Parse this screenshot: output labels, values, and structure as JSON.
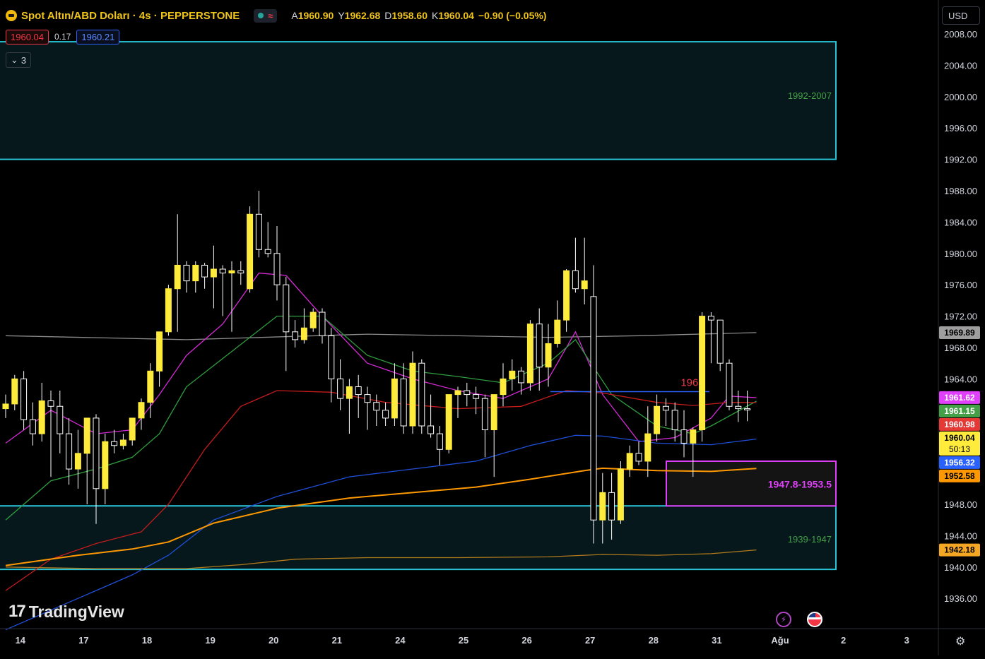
{
  "header": {
    "symbol_title": "Spot Altın/ABD Doları · 4s · PEPPERSTONE",
    "ohlc": [
      {
        "k": "A",
        "v": "1960.90"
      },
      {
        "k": "Y",
        "v": "1962.68"
      },
      {
        "k": "D",
        "v": "1958.60"
      },
      {
        "k": "K",
        "v": "1960.04"
      }
    ],
    "change": "−0.90 (−0.05%)",
    "sell_price": "1960.04",
    "spread": "0.17",
    "buy_price": "1960.21",
    "indicators_count": "3",
    "currency": "USD",
    "icons": [
      "gold-coin-icon",
      "market-open-dot-icon",
      "wave-icon",
      "chevron-down-icon",
      "bolt-icon",
      "us-flag-icon",
      "gear-icon"
    ]
  },
  "branding": {
    "logo_text": "TradingView",
    "logo_mark": "17"
  },
  "chart_data": {
    "type": "candlestick",
    "y_axis": {
      "range": [
        1933,
        2010
      ],
      "ticks": [
        2008,
        2004,
        2000,
        1996,
        1992,
        1988,
        1984,
        1980,
        1976,
        1972,
        1968,
        1964,
        1960,
        1956,
        1952,
        1948,
        1944,
        1940,
        1936
      ],
      "tick_labels": [
        "2008.00",
        "2004.00",
        "2000.00",
        "1996.00",
        "1992.00",
        "1988.00",
        "1984.00",
        "1980.00",
        "1976.00",
        "1972.00",
        "1968.00",
        "1964.00",
        "1960.00",
        "1956.00",
        "1952.00",
        "1948.00",
        "1944.00",
        "1940.00",
        "1936.00"
      ]
    },
    "x_axis": {
      "tick_labels": [
        "14",
        "17",
        "18",
        "19",
        "20",
        "21",
        "24",
        "25",
        "26",
        "27",
        "28",
        "31",
        "Ağu",
        "2",
        "3"
      ],
      "tick_bar_index": [
        1,
        8,
        15,
        22,
        29,
        36,
        43,
        50,
        57,
        64,
        71,
        78,
        85,
        92,
        99
      ]
    },
    "candles": [
      [
        1960.2,
        1962,
        1959,
        1960.8
      ],
      [
        1960.8,
        1964.5,
        1960,
        1964
      ],
      [
        1964,
        1965,
        1957.5,
        1958.8
      ],
      [
        1958.8,
        1961,
        1955.5,
        1957
      ],
      [
        1957,
        1963.5,
        1956,
        1961.2
      ],
      [
        1961.2,
        1962.5,
        1951.5,
        1960.5
      ],
      [
        1960.5,
        1962.5,
        1954.5,
        1957
      ],
      [
        1957,
        1959,
        1950.5,
        1952.5
      ],
      [
        1952.5,
        1957.5,
        1950,
        1954.5
      ],
      [
        1954.5,
        1958,
        1948,
        1959
      ],
      [
        1959,
        1959.5,
        1945.5,
        1950
      ],
      [
        1950,
        1957,
        1948,
        1956
      ],
      [
        1956,
        1957.5,
        1954.5,
        1955.5
      ],
      [
        1955.5,
        1957,
        1955,
        1956.2
      ],
      [
        1956.2,
        1959,
        1955.5,
        1959
      ],
      [
        1959,
        1961.5,
        1957.5,
        1961
      ],
      [
        1961,
        1966,
        1959,
        1965
      ],
      [
        1965,
        1969,
        1963,
        1970
      ],
      [
        1970,
        1976,
        1969.5,
        1975.5
      ],
      [
        1975.5,
        1985,
        1970,
        1978.5
      ],
      [
        1978.5,
        1979,
        1975,
        1976.5
      ],
      [
        1976.5,
        1979,
        1975,
        1978.5
      ],
      [
        1978.5,
        1978.8,
        1975.5,
        1977
      ],
      [
        1977,
        1981,
        1973,
        1978
      ],
      [
        1978,
        1978.5,
        1972,
        1977.5
      ],
      [
        1977.5,
        1979,
        1970,
        1977.8
      ],
      [
        1977.8,
        1979,
        1976,
        1977.5
      ],
      [
        1975.5,
        1986,
        1975,
        1985
      ],
      [
        1985,
        1988,
        1979.5,
        1980.5
      ],
      [
        1980.5,
        1984,
        1979.5,
        1980
      ],
      [
        1980,
        1983.5,
        1974,
        1976
      ],
      [
        1976,
        1977,
        1965,
        1970
      ],
      [
        1970,
        1971.5,
        1968,
        1969
      ],
      [
        1969,
        1973,
        1968.5,
        1970.5
      ],
      [
        1970.5,
        1973,
        1970,
        1972.5
      ],
      [
        1972.5,
        1973,
        1968.5,
        1969.5
      ],
      [
        1969.5,
        1970.5,
        1961,
        1964
      ],
      [
        1964,
        1966.5,
        1960,
        1961.5
      ],
      [
        1961.5,
        1964,
        1957,
        1963
      ],
      [
        1963,
        1964.5,
        1959,
        1962
      ],
      [
        1962,
        1963,
        1957.5,
        1961
      ],
      [
        1961,
        1962,
        1958,
        1960
      ],
      [
        1960,
        1961,
        1958,
        1959
      ],
      [
        1959,
        1966,
        1958,
        1964
      ],
      [
        1964,
        1966,
        1957,
        1958
      ],
      [
        1958,
        1967.5,
        1957,
        1966
      ],
      [
        1966,
        1966.5,
        1957,
        1958
      ],
      [
        1958,
        1962,
        1956.5,
        1957
      ],
      [
        1957,
        1958,
        1953,
        1955
      ],
      [
        1955,
        1962,
        1954.5,
        1962
      ],
      [
        1962,
        1963,
        1959,
        1962.5
      ],
      [
        1962.5,
        1963.5,
        1960.5,
        1962
      ],
      [
        1962,
        1963,
        1959.5,
        1961.5
      ],
      [
        1961.5,
        1962,
        1954,
        1957.5
      ],
      [
        1957.5,
        1962,
        1951.5,
        1962
      ],
      [
        1962,
        1966,
        1960.5,
        1964
      ],
      [
        1964,
        1966.5,
        1962.5,
        1965
      ],
      [
        1965,
        1965.5,
        1962,
        1963.5
      ],
      [
        1963.5,
        1971.5,
        1962.5,
        1971
      ],
      [
        1971,
        1973,
        1962.5,
        1965.5
      ],
      [
        1965.5,
        1971,
        1963,
        1968.5
      ],
      [
        1968.5,
        1974,
        1968,
        1971.5
      ],
      [
        1971.5,
        1978,
        1970,
        1977.8
      ],
      [
        1977.8,
        1982,
        1975,
        1975.5
      ],
      [
        1975.5,
        1982,
        1973.5,
        1976.5
      ],
      [
        1974.5,
        1978.5,
        1943,
        1946
      ],
      [
        1946,
        1952,
        1943,
        1949.5
      ],
      [
        1949.5,
        1952,
        1943.5,
        1946
      ],
      [
        1946,
        1953.5,
        1945.5,
        1952.5
      ],
      [
        1952.5,
        1955.5,
        1951.5,
        1954.5
      ],
      [
        1954.5,
        1956,
        1953,
        1953.5
      ],
      [
        1953.5,
        1960.5,
        1951.5,
        1957
      ],
      [
        1957,
        1962,
        1956,
        1960.5
      ],
      [
        1960.5,
        1961.5,
        1958,
        1960
      ],
      [
        1960,
        1961,
        1956,
        1957.5
      ],
      [
        1957.5,
        1960,
        1954,
        1955.8
      ],
      [
        1955.8,
        1957.8,
        1951.5,
        1957.5
      ],
      [
        1957.5,
        1972.5,
        1956,
        1972
      ],
      [
        1972,
        1972.5,
        1966,
        1971.5
      ],
      [
        1971.5,
        1971.5,
        1965,
        1966
      ],
      [
        1966,
        1966.5,
        1960,
        1960.5
      ],
      [
        1960.5,
        1962.5,
        1958.5,
        1960.2
      ],
      [
        1960.2,
        1962.5,
        1958.6,
        1960.04
      ]
    ],
    "zones": [
      {
        "label": "1992-2007",
        "from": 1992,
        "to": 2007
      },
      {
        "label": "1939-1947",
        "from": 1939.7,
        "to": 1947.8
      },
      {
        "label": "1947.8-1953.5",
        "from": 1947.8,
        "to": 1953.5
      }
    ],
    "horizontal_levels": [
      {
        "label": "1963",
        "price": 1963
      }
    ],
    "price_labels": [
      {
        "text": "1969.89",
        "price": 1969.89,
        "color": "#9e9e9e"
      },
      {
        "text": "1961.62",
        "price": 1961.62,
        "color": "#e040fb"
      },
      {
        "text": "1961.15",
        "price": 1961.15,
        "color": "#43a047"
      },
      {
        "text": "1960.98",
        "price": 1960.98,
        "color": "#e53935"
      },
      {
        "text": "1960.04",
        "price": 1960.04,
        "color": "#ffeb3b",
        "subtext": "50:13"
      },
      {
        "text": "1956.32",
        "price": 1956.32,
        "color": "#2962ff"
      },
      {
        "text": "1952.58",
        "price": 1952.58,
        "color": "#ff9800"
      },
      {
        "text": "1942.18",
        "price": 1942.18,
        "color": "#f5a623"
      }
    ],
    "colors": {
      "candle_up": "#ffeb3b",
      "candle_down": "#000000",
      "wick": "#ffffff",
      "zone_border": "#29c5d6",
      "zone_fill": "#06181c",
      "zone_label": "#43a047",
      "zone3_border": "#e040fb",
      "zone3_label": "#e040fb",
      "level_line": "#2962ff",
      "level_label": "#f23645",
      "ma_gray": "#8a8a8a",
      "ma_magenta": "#d62ad6",
      "ma_green": "#2e9e3e",
      "ma_red": "#c41c1c",
      "ma_blue": "#1e4fd8",
      "ma_orange": "#ff9800",
      "ma_darkorange": "#b07a1a"
    },
    "moving_averages": [
      {
        "color": "#8a8a8a",
        "points": [
          [
            0,
            1969.5
          ],
          [
            20,
            1969
          ],
          [
            40,
            1969.7
          ],
          [
            60,
            1969.3
          ],
          [
            70,
            1969.5
          ],
          [
            83,
            1969.9
          ]
        ]
      },
      {
        "color": "#d62ad6",
        "points": [
          [
            0,
            1955.8
          ],
          [
            5,
            1960
          ],
          [
            10,
            1957
          ],
          [
            14,
            1957.5
          ],
          [
            17,
            1962
          ],
          [
            20,
            1967
          ],
          [
            24,
            1971
          ],
          [
            28,
            1977.5
          ],
          [
            31,
            1977.2
          ],
          [
            35,
            1972
          ],
          [
            40,
            1966
          ],
          [
            45,
            1964
          ],
          [
            50,
            1962.5
          ],
          [
            55,
            1961.5
          ],
          [
            60,
            1964
          ],
          [
            63,
            1970
          ],
          [
            66,
            1962
          ],
          [
            70,
            1956
          ],
          [
            74,
            1956.5
          ],
          [
            78,
            1959
          ],
          [
            80,
            1961.8
          ],
          [
            83,
            1961.6
          ]
        ]
      },
      {
        "color": "#2e9e3e",
        "points": [
          [
            0,
            1946
          ],
          [
            5,
            1951
          ],
          [
            10,
            1952.5
          ],
          [
            14,
            1954
          ],
          [
            17,
            1957
          ],
          [
            20,
            1963
          ],
          [
            25,
            1967.5
          ],
          [
            30,
            1972
          ],
          [
            35,
            1972
          ],
          [
            40,
            1967
          ],
          [
            45,
            1965
          ],
          [
            50,
            1964.3
          ],
          [
            55,
            1963.5
          ],
          [
            60,
            1966
          ],
          [
            63,
            1969
          ],
          [
            67,
            1962
          ],
          [
            72,
            1958
          ],
          [
            76,
            1957
          ],
          [
            78,
            1958
          ],
          [
            83,
            1961.15
          ]
        ]
      },
      {
        "color": "#c41c1c",
        "points": [
          [
            0,
            1937
          ],
          [
            5,
            1941
          ],
          [
            10,
            1943
          ],
          [
            15,
            1944.5
          ],
          [
            18,
            1948
          ],
          [
            22,
            1955
          ],
          [
            26,
            1960.5
          ],
          [
            30,
            1962.5
          ],
          [
            36,
            1962.3
          ],
          [
            42,
            1961
          ],
          [
            50,
            1960.2
          ],
          [
            57,
            1960.5
          ],
          [
            62,
            1962.5
          ],
          [
            66,
            1962.2
          ],
          [
            72,
            1961
          ],
          [
            76,
            1960.6
          ],
          [
            80,
            1961
          ],
          [
            83,
            1960.98
          ]
        ]
      },
      {
        "color": "#1e4fd8",
        "points": [
          [
            0,
            1932
          ],
          [
            8,
            1936
          ],
          [
            14,
            1939
          ],
          [
            18,
            1941.5
          ],
          [
            23,
            1946
          ],
          [
            30,
            1949
          ],
          [
            38,
            1951.5
          ],
          [
            45,
            1952.5
          ],
          [
            52,
            1953.5
          ],
          [
            58,
            1955.5
          ],
          [
            63,
            1956.8
          ],
          [
            66,
            1956.7
          ],
          [
            72,
            1955.8
          ],
          [
            78,
            1955.6
          ],
          [
            83,
            1956.32
          ]
        ]
      },
      {
        "color": "#ff9800",
        "points": [
          [
            0,
            1940.2
          ],
          [
            8,
            1941.5
          ],
          [
            14,
            1942.3
          ],
          [
            18,
            1943.2
          ],
          [
            23,
            1945.6
          ],
          [
            30,
            1947.5
          ],
          [
            38,
            1948.8
          ],
          [
            45,
            1949.5
          ],
          [
            52,
            1950.2
          ],
          [
            58,
            1951.2
          ],
          [
            64,
            1952.3
          ],
          [
            66,
            1952.6
          ],
          [
            72,
            1952.3
          ],
          [
            78,
            1952.2
          ],
          [
            83,
            1952.58
          ]
        ]
      },
      {
        "color": "#b07a1a",
        "points": [
          [
            0,
            1940
          ],
          [
            10,
            1939.8
          ],
          [
            20,
            1939.8
          ],
          [
            26,
            1940.3
          ],
          [
            32,
            1941
          ],
          [
            40,
            1941.2
          ],
          [
            50,
            1941.2
          ],
          [
            60,
            1941.3
          ],
          [
            66,
            1941.6
          ],
          [
            72,
            1941.5
          ],
          [
            78,
            1941.7
          ],
          [
            83,
            1942.18
          ]
        ]
      }
    ]
  }
}
